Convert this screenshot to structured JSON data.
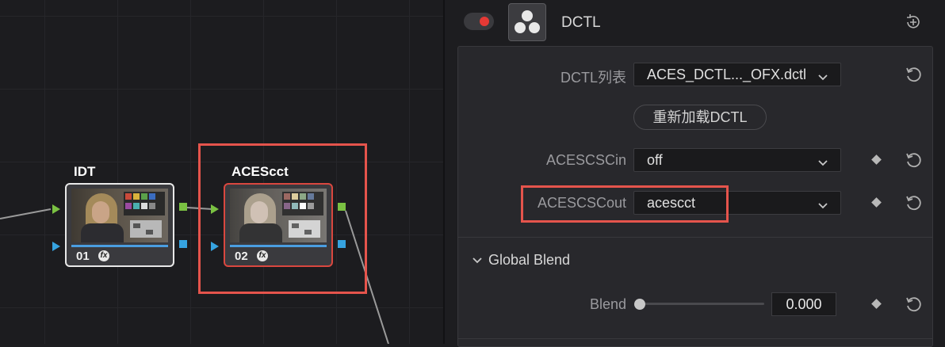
{
  "graph": {
    "nodes": [
      {
        "title": "IDT",
        "number": "01",
        "fx": "fx"
      },
      {
        "title": "ACEScct",
        "number": "02",
        "fx": "fx"
      }
    ]
  },
  "inspector": {
    "plugin_name": "DCTL",
    "fields": {
      "dctl_list": {
        "label": "DCTL列表",
        "value": "ACES_DCTL..._OFX.dctl"
      },
      "reload_label": "重新加载DCTL",
      "acescsc_in": {
        "label": "ACESCSCin",
        "value": "off"
      },
      "acescsc_out": {
        "label": "ACESCSCout",
        "value": "acescct"
      }
    },
    "global_blend": {
      "title": "Global Blend",
      "blend_label": "Blend",
      "blend_value": "0.000"
    }
  },
  "colors": {
    "highlight": "#e5544c",
    "port_green": "#7ac142",
    "port_blue": "#36a3e0",
    "toggle_on": "#e53935"
  }
}
